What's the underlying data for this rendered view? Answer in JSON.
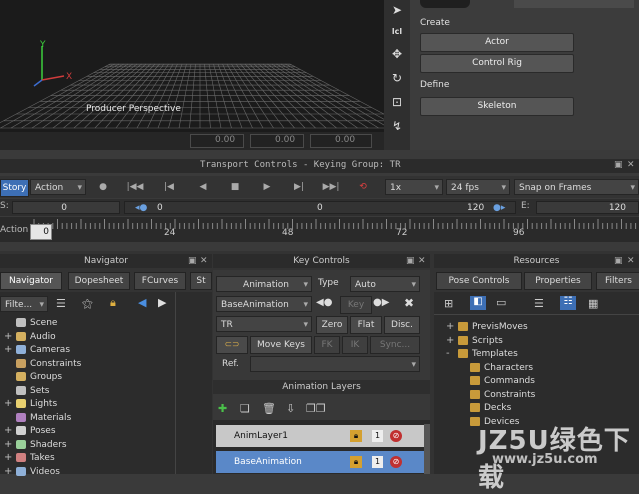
{
  "viewport": {
    "label": "Producer Perspective",
    "axis_x": "X",
    "axis_y": "Y",
    "coords": [
      "0.00",
      "0.00",
      "0.00"
    ]
  },
  "character_controls": {
    "section_create": "Create",
    "actor_button": "Actor",
    "control_rig_button": "Control Rig",
    "section_define": "Define",
    "skeleton_button": "Skeleton"
  },
  "transport": {
    "title": "Transport Controls  -  Keying Group: TR",
    "story_button": "Story",
    "mode_value": "Action",
    "speed_value": "1x",
    "fps_value": "24 fps",
    "snap_value": "Snap on Frames",
    "start_label": "S:",
    "start_value": "0",
    "current_start": "0",
    "current_mid": "0",
    "current_end": "120",
    "end_label": "E:",
    "end_value": "120",
    "action_label": "Action",
    "timeline_ticks": [
      "0",
      "24",
      "48",
      "72",
      "96"
    ]
  },
  "navigator": {
    "header": "Navigator",
    "tabs": [
      "Navigator",
      "Dopesheet",
      "FCurves",
      "St"
    ],
    "filter_label": "Filte...",
    "items": [
      "Scene",
      "Audio",
      "Cameras",
      "Constraints",
      "Groups",
      "Sets",
      "Lights",
      "Materials",
      "Poses",
      "Shaders",
      "Takes",
      "Videos"
    ]
  },
  "key_controls": {
    "header": "Key Controls",
    "animation_dropdown": "Animation",
    "type_label": "Type",
    "type_value": "Auto",
    "base_animation_value": "BaseAnimation",
    "key_button": "Key",
    "tr_value": "TR",
    "zero_button": "Zero",
    "flat_button": "Flat",
    "disc_button": "Disc.",
    "move_keys_button": "Move Keys",
    "fk_button": "FK",
    "ik_button": "IK",
    "sync_button": "Sync...",
    "ref_label": "Ref.",
    "layers_header": "Animation Layers",
    "layers": [
      {
        "name": "AnimLayer1",
        "lock": "lock-icon",
        "weight": "1"
      },
      {
        "name": "BaseAnimation",
        "lock": "lock-icon",
        "weight": "1"
      }
    ]
  },
  "resources": {
    "header": "Resources",
    "tabs": [
      "Pose Controls",
      "Properties",
      "Filters"
    ],
    "items": [
      "PrevisMoves",
      "Scripts",
      "Templates",
      "Characters",
      "Commands",
      "Constraints",
      "Decks",
      "Devices"
    ]
  },
  "watermark": {
    "main": "JZ5U绿色下载",
    "sub": "www.jz5u.com"
  }
}
